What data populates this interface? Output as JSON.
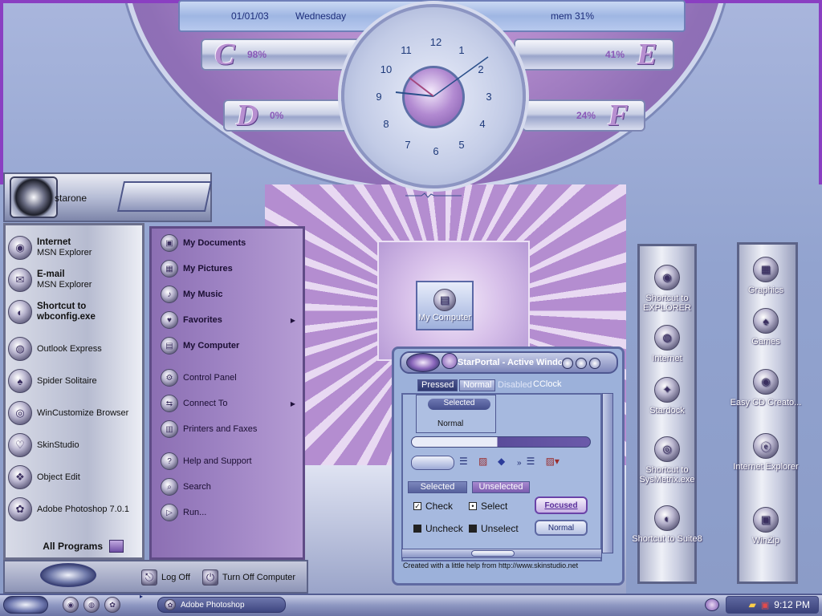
{
  "topbar": {
    "date": "01/01/03",
    "weekday": "Wednesday",
    "mem": "mem 31%"
  },
  "drives": [
    {
      "letter": "C",
      "pct": "98%"
    },
    {
      "letter": "E",
      "pct": "41%"
    },
    {
      "letter": "D",
      "pct": "0%"
    },
    {
      "letter": "F",
      "pct": "24%"
    }
  ],
  "clock_numbers": [
    "12",
    "1",
    "2",
    "3",
    "4",
    "5",
    "6",
    "7",
    "8",
    "9",
    "10",
    "11"
  ],
  "start_menu": {
    "user": "starone",
    "left_items": [
      {
        "title": "Internet",
        "sub": "MSN Explorer",
        "icon": "internet-icon"
      },
      {
        "title": "E-mail",
        "sub": "MSN Explorer",
        "icon": "email-icon"
      },
      {
        "title": "Shortcut to wbconfig.exe",
        "sub": "",
        "icon": "wbconfig-icon"
      },
      {
        "title": "Outlook Express",
        "sub": "",
        "icon": "outlook-icon"
      },
      {
        "title": "Spider Solitaire",
        "sub": "",
        "icon": "spider-solitaire-icon"
      },
      {
        "title": "WinCustomize Browser",
        "sub": "",
        "icon": "wincustomize-icon"
      },
      {
        "title": "SkinStudio",
        "sub": "",
        "icon": "skinstudio-icon"
      },
      {
        "title": "Object Edit",
        "sub": "",
        "icon": "object-edit-icon"
      },
      {
        "title": "Adobe Photoshop 7.0.1",
        "sub": "",
        "icon": "photoshop-icon"
      }
    ],
    "all_programs": "All Programs",
    "right_items": [
      {
        "label": "My Documents",
        "bold": true,
        "arrow": false
      },
      {
        "label": "My Pictures",
        "bold": true,
        "arrow": false
      },
      {
        "label": "My Music",
        "bold": true,
        "arrow": false
      },
      {
        "label": "Favorites",
        "bold": true,
        "arrow": true
      },
      {
        "label": "My Computer",
        "bold": true,
        "arrow": false
      },
      {
        "label": "Control Panel",
        "bold": false,
        "arrow": false
      },
      {
        "label": "Connect To",
        "bold": false,
        "arrow": true
      },
      {
        "label": "Printers and Faxes",
        "bold": false,
        "arrow": false
      },
      {
        "label": "Help and Support",
        "bold": false,
        "arrow": false
      },
      {
        "label": "Search",
        "bold": false,
        "arrow": false
      },
      {
        "label": "Run...",
        "bold": false,
        "arrow": false
      }
    ],
    "logoff": "Log Off",
    "turnoff": "Turn Off Computer"
  },
  "desktop": {
    "my_computer": "My Computer",
    "panel1": [
      {
        "label": "Shortcut to EXPLORER"
      },
      {
        "label": "Internet"
      },
      {
        "label": "Stardock"
      },
      {
        "label": "Shortcut to SysMetrix.exe"
      },
      {
        "label": "Shortcut to Suite8"
      }
    ],
    "panel2": [
      {
        "label": "Graphics"
      },
      {
        "label": "Games"
      },
      {
        "label": "Easy CD Creato..."
      },
      {
        "label": "Internet Explorer"
      },
      {
        "label": "WinZip"
      }
    ]
  },
  "portal": {
    "title": "StarPortal - Active Window",
    "tabs": [
      "Pressed",
      "Normal",
      "Disabled",
      "CClock"
    ],
    "listbox_selected": "Selected",
    "listbox_normal": "Normal",
    "tab2": [
      "Selected",
      "Unselected"
    ],
    "check": "Check",
    "uncheck": "Uncheck",
    "select": "Select",
    "unselect": "Unselect",
    "focused": "Focused",
    "normal_btn": "Normal",
    "status": "Created with a little help from http://www.skinstudio.net"
  },
  "taskbar": {
    "task": "Adobe Photoshop",
    "time": "9:12 PM"
  }
}
